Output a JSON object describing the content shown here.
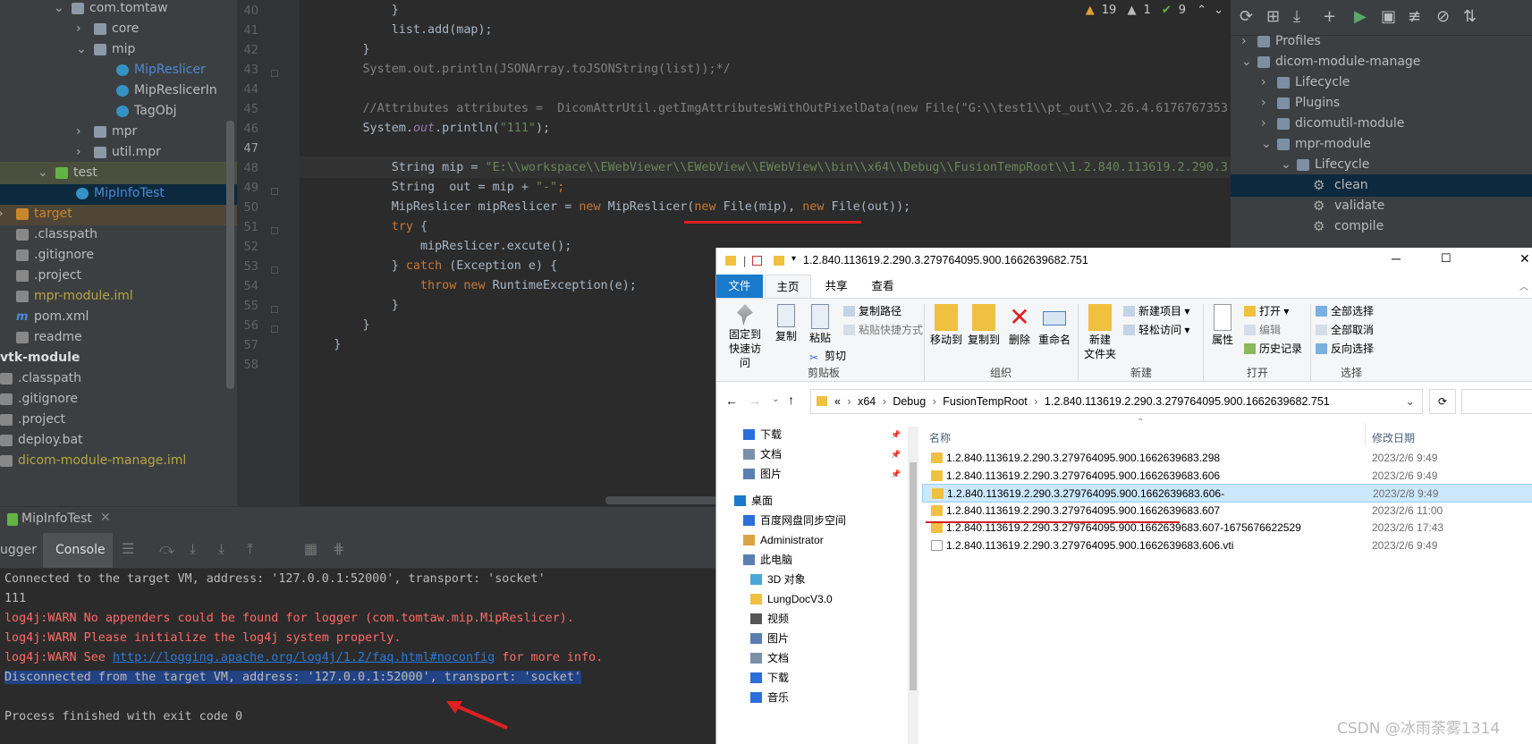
{
  "project_tree": [
    {
      "label": "com.tomtaw",
      "icon": "folder-icon",
      "arrow": "down",
      "indent": 80,
      "color": "#bbbbbb"
    },
    {
      "label": "core",
      "icon": "folder-icon",
      "arrow": "right",
      "indent": 105,
      "color": "#bbbbbb"
    },
    {
      "label": "mip",
      "icon": "folder-icon",
      "arrow": "down",
      "indent": 105,
      "color": "#bbbbbb"
    },
    {
      "label": "MipReslicer",
      "icon": "class-icon",
      "arrow": "",
      "indent": 130,
      "color": "#4b8ad6"
    },
    {
      "label": "MipReslicerIn",
      "icon": "class-icon",
      "arrow": "",
      "indent": 130,
      "color": "#bbbbbb"
    },
    {
      "label": "TagObj",
      "icon": "class-icon",
      "arrow": "",
      "indent": 130,
      "color": "#bbbbbb"
    },
    {
      "label": "mpr",
      "icon": "folder-icon",
      "arrow": "right",
      "indent": 105,
      "color": "#bbbbbb"
    },
    {
      "label": "util.mpr",
      "icon": "folder-icon",
      "arrow": "right",
      "indent": 105,
      "color": "#bbbbbb"
    },
    {
      "label": "test",
      "icon": "test-folder-icon",
      "arrow": "down",
      "indent": 62,
      "color": "#bbbbbb"
    },
    {
      "label": "MipInfoTest",
      "icon": "test-class-icon",
      "arrow": "",
      "indent": 85,
      "color": "#4b8ad6"
    },
    {
      "label": "target",
      "icon": "target-folder-icon",
      "arrow": "right",
      "indent": 18,
      "color": "#c8872c"
    },
    {
      "label": ".classpath",
      "icon": "file-icon",
      "arrow": "",
      "indent": 18,
      "color": "#bbbbbb"
    },
    {
      "label": ".gitignore",
      "icon": "file-icon",
      "arrow": "",
      "indent": 18,
      "color": "#bbbbbb"
    },
    {
      "label": ".project",
      "icon": "file-icon",
      "arrow": "",
      "indent": 18,
      "color": "#bbbbbb"
    },
    {
      "label": "mpr-module.iml",
      "icon": "file-icon",
      "arrow": "",
      "indent": 18,
      "color": "#b5a642"
    },
    {
      "label": "pom.xml",
      "icon": "maven-icon",
      "arrow": "",
      "indent": 18,
      "color": "#bbbbbb"
    },
    {
      "label": "readme",
      "icon": "file-icon",
      "arrow": "",
      "indent": 18,
      "color": "#bbbbbb"
    },
    {
      "label": "vtk-module",
      "icon": "module-icon",
      "arrow": "",
      "indent": 0,
      "color": "#dddddd"
    },
    {
      "label": ".classpath",
      "icon": "file-icon",
      "arrow": "",
      "indent": 0,
      "color": "#bbbbbb"
    },
    {
      "label": ".gitignore",
      "icon": "file-icon",
      "arrow": "",
      "indent": 0,
      "color": "#bbbbbb"
    },
    {
      "label": ".project",
      "icon": "file-icon",
      "arrow": "",
      "indent": 0,
      "color": "#bbbbbb"
    },
    {
      "label": "deploy.bat",
      "icon": "file-icon",
      "arrow": "",
      "indent": 0,
      "color": "#bbbbbb"
    },
    {
      "label": "dicom-module-manage.iml",
      "icon": "file-icon",
      "arrow": "",
      "indent": 0,
      "color": "#b5a642"
    }
  ],
  "editor": {
    "line_numbers": [
      "40",
      "41",
      "42",
      "43",
      "44",
      "45",
      "46",
      "47",
      "48",
      "49",
      "50",
      "51",
      "52",
      "53",
      "54",
      "55",
      "56",
      "57",
      "58"
    ],
    "inspections": {
      "warnings": "19",
      "weak_warnings": "1",
      "typos": "9"
    },
    "lines": [
      [
        {
          "t": "            }",
          "c": ""
        }
      ],
      [
        {
          "t": "            list.add(map);",
          "c": ""
        }
      ],
      [
        {
          "t": "        }",
          "c": ""
        }
      ],
      [
        {
          "t": "        System.out.println(JSONArray.toJSONString(list));*/",
          "c": "cm"
        }
      ],
      [
        {
          "t": "",
          "c": ""
        }
      ],
      [
        {
          "t": "        //Attributes attributes =  DicomAttrUtil.getImgAttributesWithOutPixelData(new File(\"G:\\\\test1\\\\pt_out\\\\2.26.4.6176767353",
          "c": "cm"
        }
      ],
      [
        {
          "t": "        System.",
          "c": ""
        },
        {
          "t": "out",
          "c": "fld"
        },
        {
          "t": ".println(",
          "c": ""
        },
        {
          "t": "\"111\"",
          "c": "st"
        },
        {
          "t": ");",
          "c": ""
        }
      ],
      [
        {
          "t": "",
          "c": ""
        }
      ],
      [
        {
          "t": "            String mip = ",
          "c": ""
        },
        {
          "t": "\"E:\\\\workspace\\\\EWebViewer\\\\EWebView\\\\EWebView\\\\bin\\\\x64\\\\Debug\\\\FusionTempRoot\\\\1.2.840.113619.2.290.3.",
          "c": "st"
        }
      ],
      [
        {
          "t": "            String  out = mip + ",
          "c": ""
        },
        {
          "t": "\"-\"",
          "c": "st"
        },
        {
          "t": ";",
          "c": "kw"
        }
      ],
      [
        {
          "t": "            MipReslicer mipReslicer = ",
          "c": ""
        },
        {
          "t": "new ",
          "c": "kw"
        },
        {
          "t": "MipReslicer(",
          "c": ""
        },
        {
          "t": "new ",
          "c": "kw"
        },
        {
          "t": "File(mip), ",
          "c": ""
        },
        {
          "t": "new ",
          "c": "kw"
        },
        {
          "t": "File(out));",
          "c": ""
        }
      ],
      [
        {
          "t": "            ",
          "c": ""
        },
        {
          "t": "try ",
          "c": "kw"
        },
        {
          "t": "{",
          "c": ""
        }
      ],
      [
        {
          "t": "                mipReslicer.excute();",
          "c": ""
        }
      ],
      [
        {
          "t": "            } ",
          "c": ""
        },
        {
          "t": "catch ",
          "c": "kw"
        },
        {
          "t": "(Exception e) {",
          "c": ""
        }
      ],
      [
        {
          "t": "                ",
          "c": ""
        },
        {
          "t": "throw new ",
          "c": "kw"
        },
        {
          "t": "RuntimeException(e);",
          "c": ""
        }
      ],
      [
        {
          "t": "            }",
          "c": ""
        }
      ],
      [
        {
          "t": "        }",
          "c": ""
        }
      ],
      [
        {
          "t": "    }",
          "c": ""
        }
      ],
      [
        {
          "t": "",
          "c": ""
        }
      ]
    ]
  },
  "maven": {
    "items": [
      {
        "label": "Profiles",
        "arrow": "right",
        "indent": 0,
        "kind": "folder"
      },
      {
        "label": "dicom-module-manage",
        "arrow": "down",
        "indent": 0,
        "kind": "module"
      },
      {
        "label": "Lifecycle",
        "arrow": "right",
        "indent": 22,
        "kind": "folder"
      },
      {
        "label": "Plugins",
        "arrow": "right",
        "indent": 22,
        "kind": "folder"
      },
      {
        "label": "dicomutil-module",
        "arrow": "right",
        "indent": 22,
        "kind": "module"
      },
      {
        "label": "mpr-module",
        "arrow": "down",
        "indent": 22,
        "kind": "module"
      },
      {
        "label": "Lifecycle",
        "arrow": "down",
        "indent": 44,
        "kind": "folder"
      },
      {
        "label": "clean",
        "arrow": "",
        "indent": 66,
        "kind": "goal",
        "selected": true
      },
      {
        "label": "validate",
        "arrow": "",
        "indent": 66,
        "kind": "goal"
      },
      {
        "label": "compile",
        "arrow": "",
        "indent": 66,
        "kind": "goal"
      }
    ]
  },
  "run": {
    "title": "MipInfoTest",
    "tabs": [
      "ugger",
      "Console"
    ],
    "console": [
      {
        "text": "Connected to the target VM, address: '127.0.0.1:52000', transport: 'socket'",
        "kind": "cw"
      },
      {
        "text": "111",
        "kind": "cw"
      },
      {
        "text": "log4j:WARN No appenders could be found for logger (com.tomtaw.mip.MipReslicer).",
        "kind": "cr"
      },
      {
        "text": "log4j:WARN Please initialize the log4j system properly.",
        "kind": "cr"
      },
      {
        "text": "",
        "kind": "link"
      },
      {
        "text": "Disconnected from the target VM, address: '127.0.0.1:52000', transport: 'socket'",
        "kind": "csel"
      },
      {
        "text": "",
        "kind": "cw"
      },
      {
        "text": "Process finished with exit code 0",
        "kind": "cw"
      }
    ],
    "link_prefix": "log4j:WARN See ",
    "link": "http://logging.apache.org/log4j/1.2/faq.html#noconfig",
    "link_suffix": " for more info."
  },
  "explorer": {
    "title": "1.2.840.113619.2.290.3.279764095.900.1662639682.751",
    "ribbon_tabs": [
      "文件",
      "主页",
      "共享",
      "查看"
    ],
    "clipboard": {
      "pin": "固定到快速访问",
      "copy": "复制",
      "paste": "粘贴",
      "copy_path": "复制路径",
      "paste_shortcut": "粘贴快捷方式",
      "cut": "剪切",
      "group": "剪贴板"
    },
    "organize": {
      "move": "移动到",
      "copyto": "复制到",
      "delete": "删除",
      "rename": "重命名",
      "group": "组织"
    },
    "new": {
      "folder": "新建\n文件夹",
      "item": "新建项目",
      "easy": "轻松访问",
      "group": "新建"
    },
    "open": {
      "props": "属性",
      "open": "打开",
      "edit": "编辑",
      "history": "历史记录",
      "group": "打开"
    },
    "select": {
      "all": "全部选择",
      "none": "全部取消",
      "invert": "反向选择",
      "group": "选择"
    },
    "breadcrumb": [
      "«",
      "x64",
      "Debug",
      "FusionTempRoot",
      "1.2.840.113619.2.290.3.279764095.900.1662639682.751"
    ],
    "nav": [
      {
        "label": "下载",
        "pin": true,
        "icon": "download-icon",
        "indent": 30
      },
      {
        "label": "文档",
        "pin": true,
        "icon": "doc-icon",
        "indent": 30
      },
      {
        "label": "图片",
        "pin": true,
        "icon": "picture-icon",
        "indent": 30
      },
      {
        "label": "桌面",
        "pin": false,
        "icon": "desktop-icon",
        "indent": 20
      },
      {
        "label": "百度网盘同步空间",
        "pin": false,
        "icon": "cloud-icon",
        "indent": 30
      },
      {
        "label": "Administrator",
        "pin": false,
        "icon": "user-icon",
        "indent": 30
      },
      {
        "label": "此电脑",
        "pin": false,
        "icon": "pc-icon",
        "indent": 30
      },
      {
        "label": "3D 对象",
        "pin": false,
        "icon": "cube-icon",
        "indent": 38
      },
      {
        "label": "LungDocV3.0",
        "pin": false,
        "icon": "folder-icon",
        "indent": 38
      },
      {
        "label": "视频",
        "pin": false,
        "icon": "video-icon",
        "indent": 38
      },
      {
        "label": "图片",
        "pin": false,
        "icon": "picture-icon",
        "indent": 38
      },
      {
        "label": "文档",
        "pin": false,
        "icon": "doc-icon",
        "indent": 38
      },
      {
        "label": "下载",
        "pin": false,
        "icon": "download-icon",
        "indent": 38
      },
      {
        "label": "音乐",
        "pin": false,
        "icon": "music-icon",
        "indent": 38
      }
    ],
    "columns": {
      "name": "名称",
      "date": "修改日期"
    },
    "files": [
      {
        "name": "1.2.840.113619.2.290.3.279764095.900.1662639683.298",
        "date": "2023/2/6 9:49",
        "type": "folder"
      },
      {
        "name": "1.2.840.113619.2.290.3.279764095.900.1662639683.606",
        "date": "2023/2/6 9:49",
        "type": "folder"
      },
      {
        "name": "1.2.840.113619.2.290.3.279764095.900.1662639683.606-",
        "date": "2023/2/8 9:49",
        "type": "folder",
        "selected": true
      },
      {
        "name": "1.2.840.113619.2.290.3.279764095.900.1662639683.607",
        "date": "2023/2/6 11:00",
        "type": "folder"
      },
      {
        "name": "1.2.840.113619.2.290.3.279764095.900.1662639683.607-1675676622529",
        "date": "2023/2/6 17:43",
        "type": "folder"
      },
      {
        "name": "1.2.840.113619.2.290.3.279764095.900.1662639683.606.vti",
        "date": "2023/2/6 9:49",
        "type": "file"
      }
    ]
  },
  "watermark": "CSDN @冰雨荼雾1314"
}
